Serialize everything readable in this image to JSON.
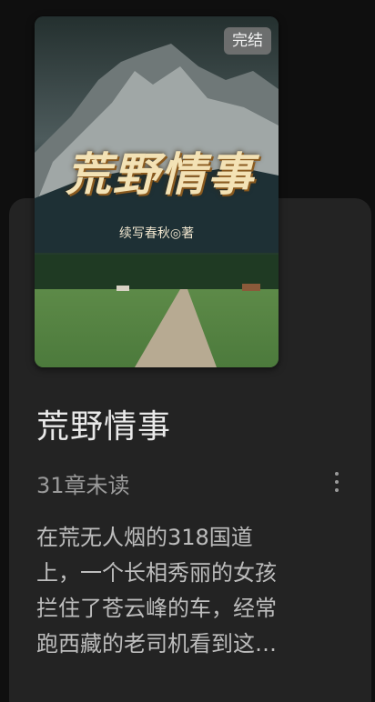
{
  "book": {
    "status_badge": "完结",
    "cover_title": "荒野情事",
    "cover_author": "续写春秋◎著",
    "title": "荒野情事",
    "unread": "31章未读",
    "description": "在荒无人烟的318国道\n上，一个长相秀丽的女孩\n拦住了苍云峰的车，经常\n跑西藏的老司机看到这…"
  },
  "icons": {
    "more": "more-vertical-icon"
  },
  "colors": {
    "background": "#0f0f0f",
    "card": "#232323",
    "title": "#e9e9e9",
    "secondary": "#9a9a9a",
    "cover_title": "#f3e2b5"
  }
}
